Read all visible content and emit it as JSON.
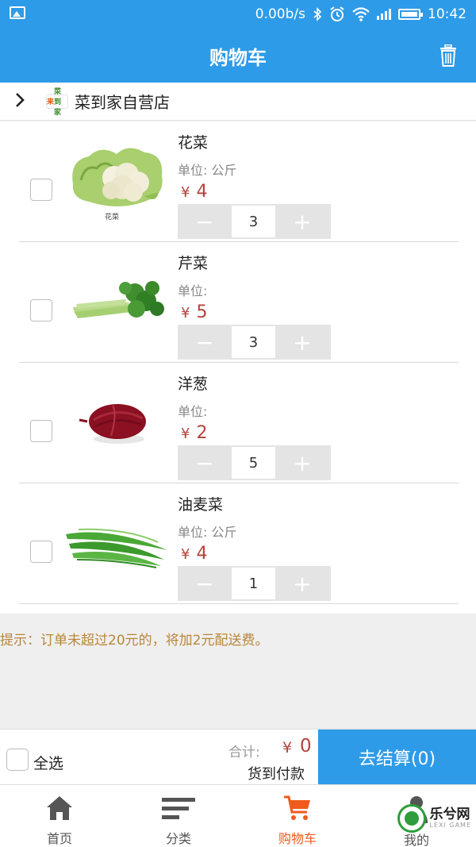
{
  "status_bar": {
    "speed": "0.00b/s",
    "time": "10:42"
  },
  "nav": {
    "title": "购物车"
  },
  "shop": {
    "name": "菜到家自营店",
    "logo_text_a": "来",
    "logo_text_b": "菜到家"
  },
  "items": [
    {
      "name": "花菜",
      "unit": "单位:  公斤",
      "currency": "¥",
      "price": "4",
      "qty": "3",
      "img_caption": "花菜"
    },
    {
      "name": "芹菜",
      "unit": "单位:",
      "currency": "¥",
      "price": "5",
      "qty": "3"
    },
    {
      "name": "洋葱",
      "unit": "单位:",
      "currency": "¥",
      "price": "2",
      "qty": "5"
    },
    {
      "name": "油麦菜",
      "unit": "单位:  公斤",
      "currency": "¥",
      "price": "4",
      "qty": "1"
    }
  ],
  "stepper": {
    "minus": "−",
    "plus": "+"
  },
  "notice": "提示：订单未超过20元的，将加2元配送费。",
  "checkout": {
    "select_all": "全选",
    "total_label": "合计:",
    "currency": "¥",
    "total": "0",
    "payment": "货到付款",
    "button": "去结算(0)"
  },
  "tabs": [
    {
      "label": "首页",
      "icon": "home-icon"
    },
    {
      "label": "分类",
      "icon": "list-icon"
    },
    {
      "label": "购物车",
      "icon": "cart-icon",
      "active": true
    },
    {
      "label": "我的",
      "icon": "user-icon"
    }
  ],
  "watermark": {
    "text": "乐兮网",
    "sub": "LEXI GAME"
  },
  "colors": {
    "primary": "#2e9be8",
    "price": "#b5433b",
    "active_tab": "#f05a1c",
    "notice": "#b8873a"
  }
}
